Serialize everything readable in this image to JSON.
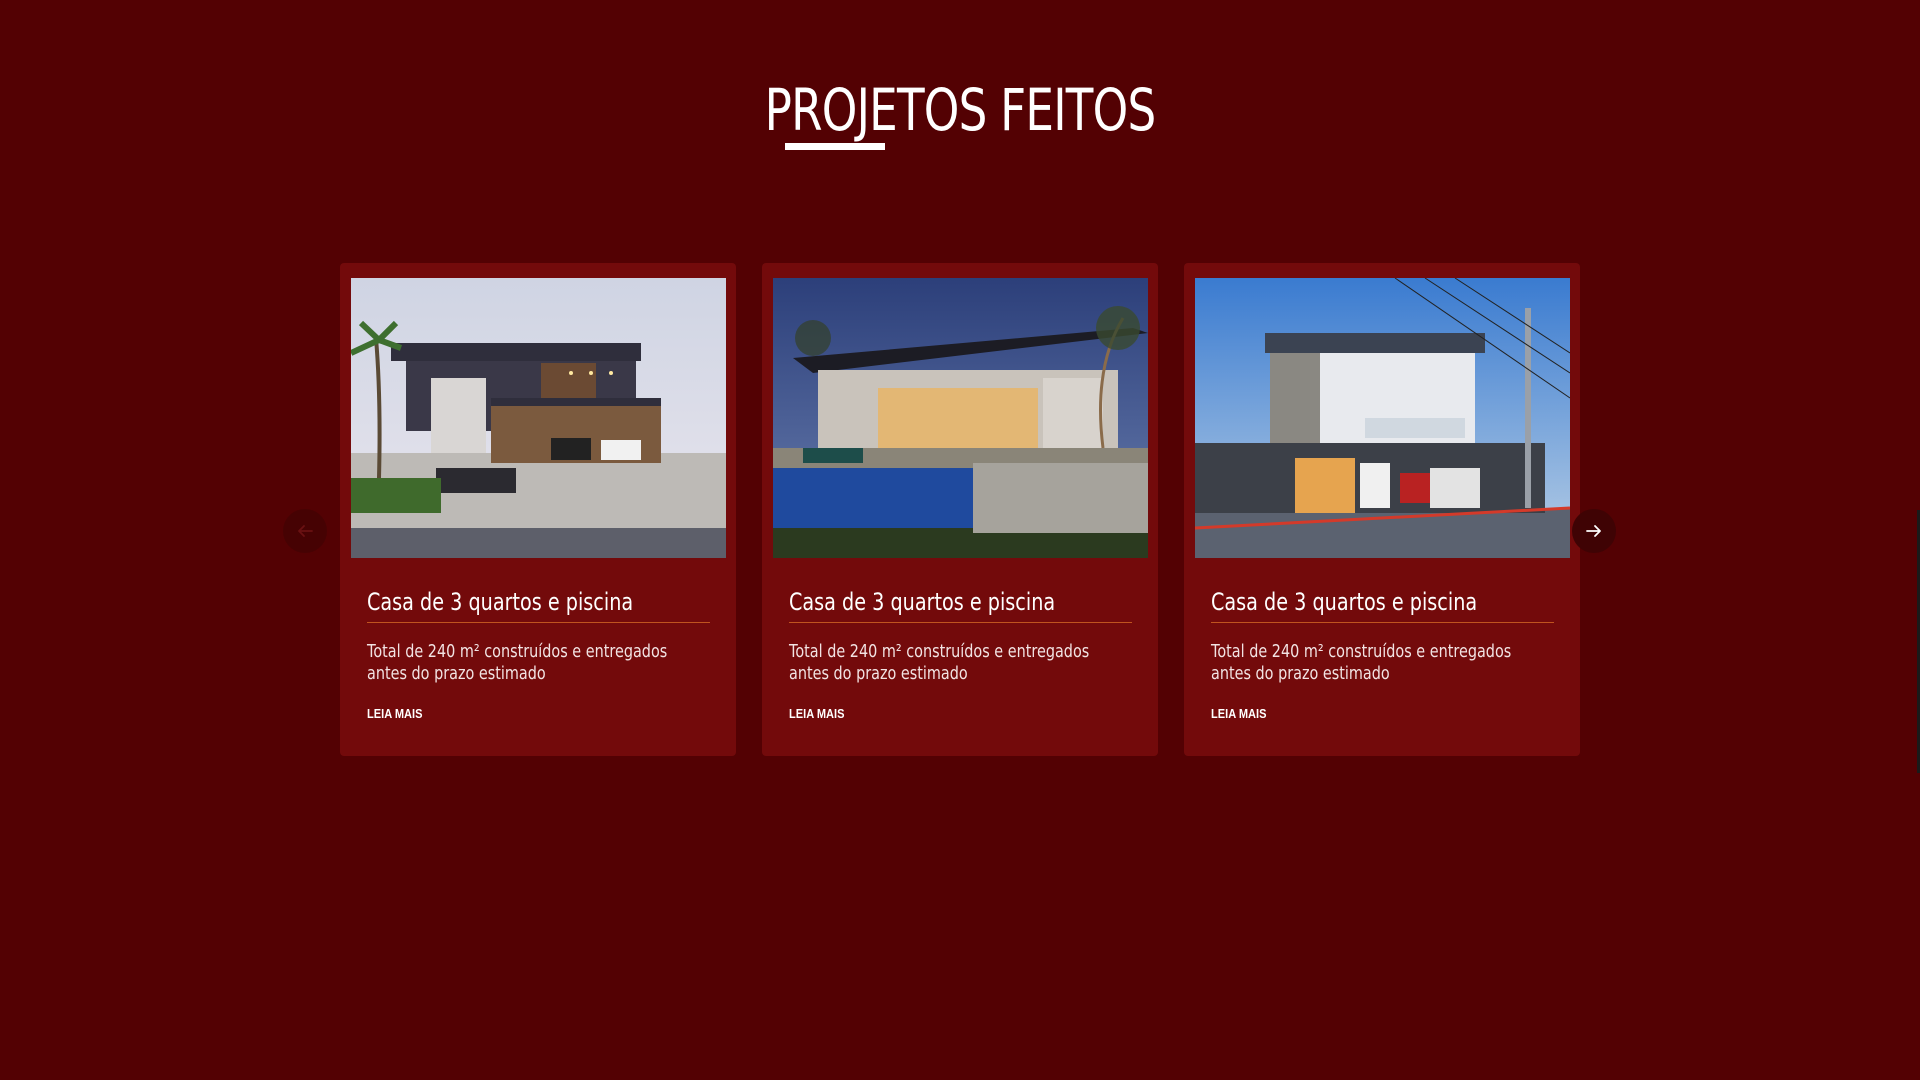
{
  "section": {
    "title": "PROJETOS FEITOS"
  },
  "carousel": {
    "prev_icon": "arrow-left-icon",
    "next_icon": "arrow-right-icon",
    "cards": [
      {
        "image": "modern-house-with-palm-and-cars",
        "title": "Casa de 3 quartos e piscina",
        "description": "Total de 240 m² construídos e entregados antes do prazo estimado",
        "link_label": "LEIA MAIS"
      },
      {
        "image": "modern-house-with-pool-at-dusk",
        "title": "Casa de 3 quartos e piscina",
        "description": "Total de 240 m² construídos e entregados antes do prazo estimado",
        "link_label": "LEIA MAIS"
      },
      {
        "image": "two-story-house-with-stone-wall",
        "title": "Casa de 3 quartos e piscina",
        "description": "Total de 240 m² construídos e entregados antes do prazo estimado",
        "link_label": "LEIA MAIS"
      }
    ]
  },
  "colors": {
    "background": "#530103",
    "card": "#730a0b",
    "title_rule": "#c0541f",
    "text": "#ffffff"
  }
}
